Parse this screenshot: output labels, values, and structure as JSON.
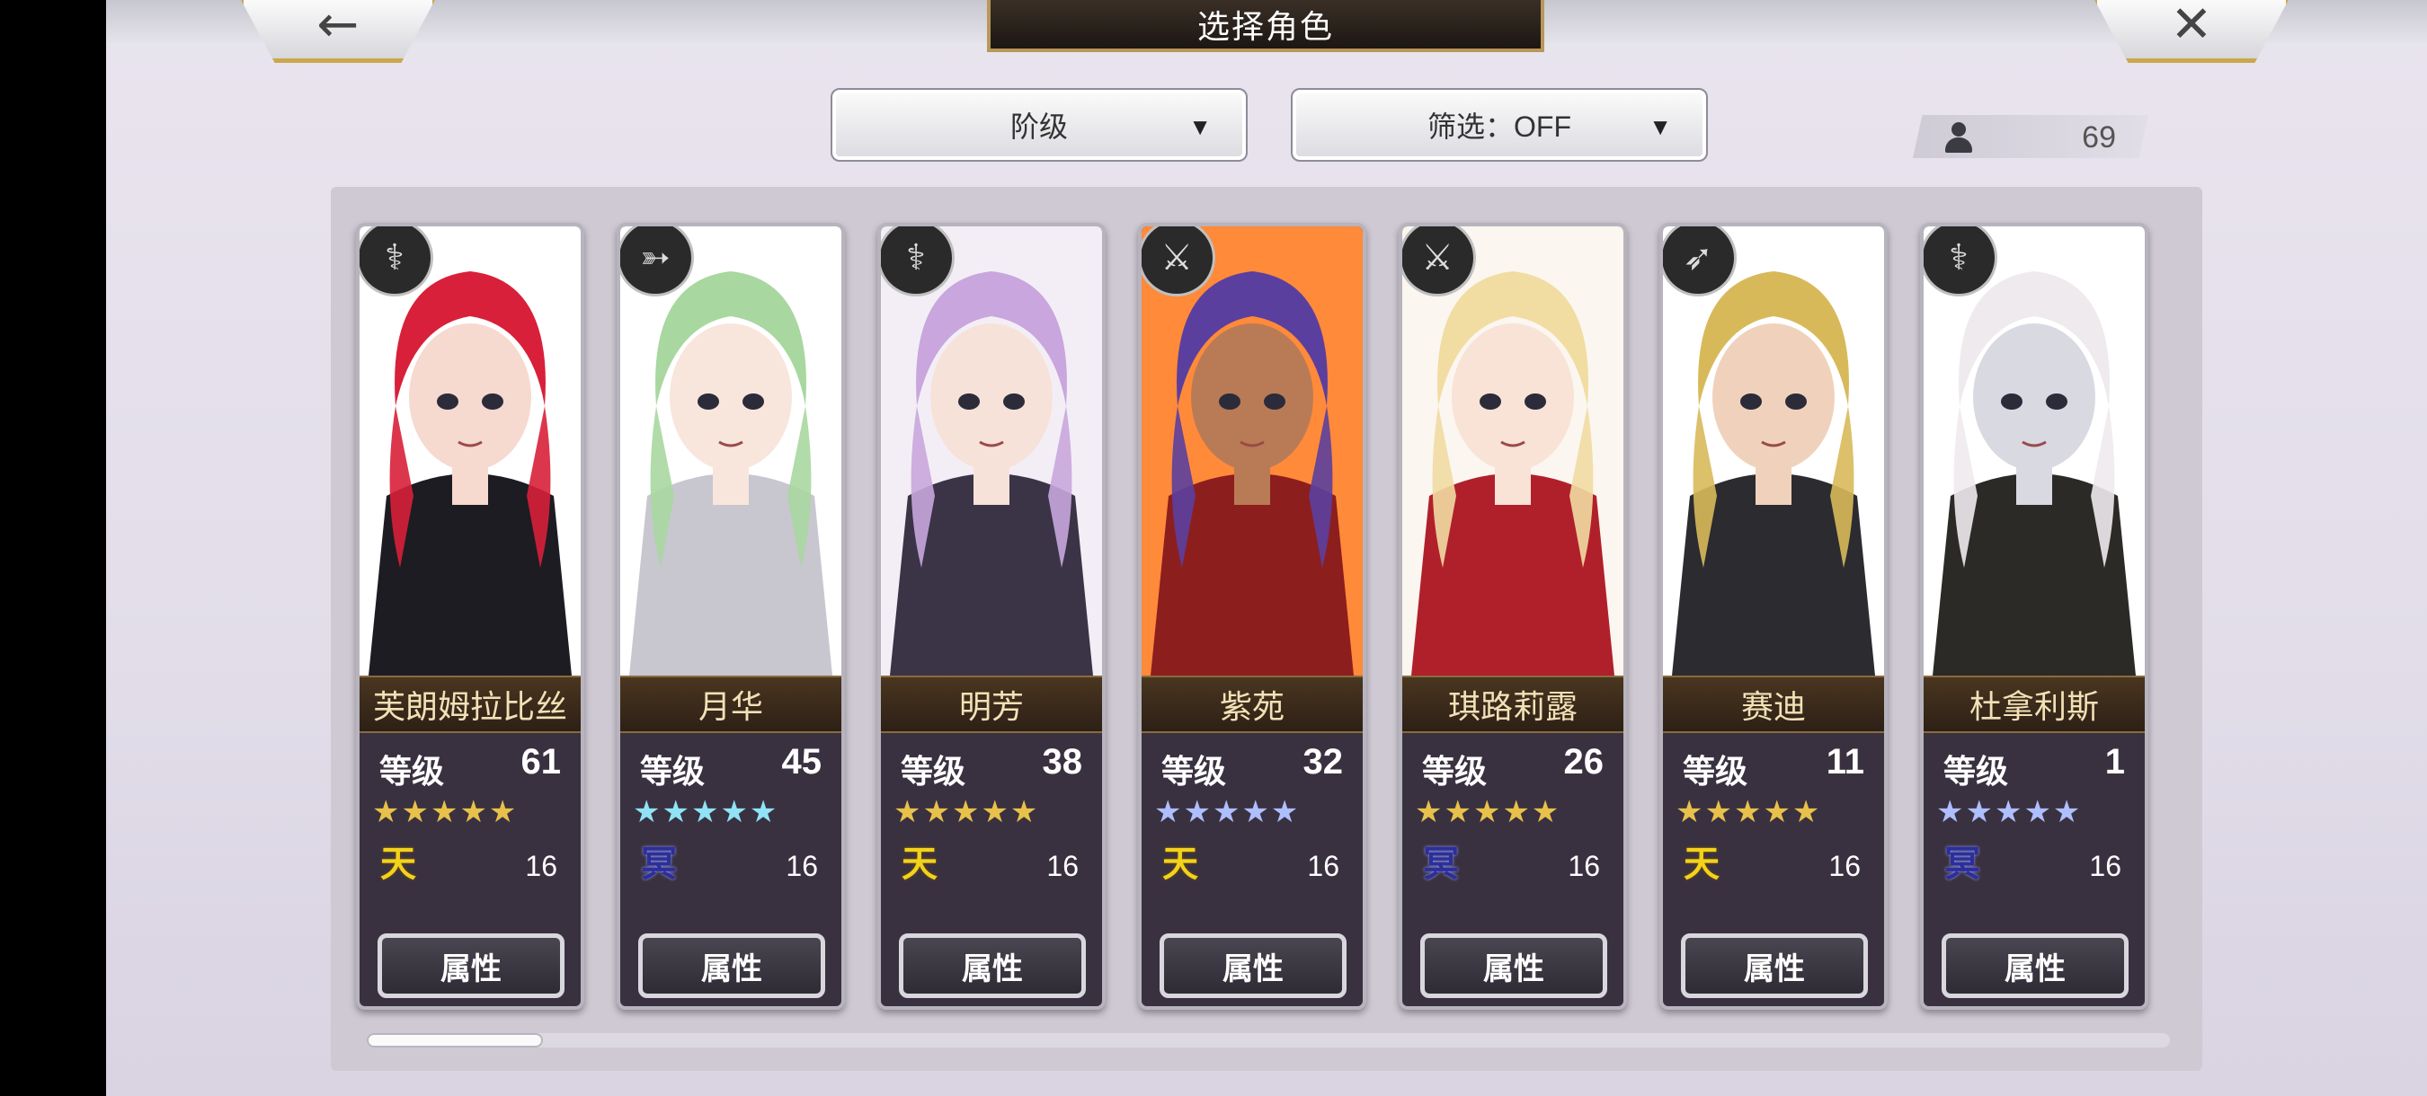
{
  "header": {
    "title": "选择角色",
    "back_icon": "back-arrow-icon",
    "close_icon": "close-icon"
  },
  "filters": {
    "sort_label": "阶级",
    "filter_label": "筛选：OFF"
  },
  "roster_count": "69",
  "level_label": "等级",
  "attribute_button": "属性",
  "colors": {
    "gold_star": "#e8c14a",
    "blue_star": "#9fb7ff",
    "heaven_element": "#f3d21c",
    "underworld_element": "#2c2f9a"
  },
  "characters": [
    {
      "name": "芙朗姆拉比丝",
      "level": "61",
      "stars": "★★★★★",
      "star_color": "gold",
      "element": "天",
      "element_type": "heaven",
      "cost": "16",
      "weapon_icon": "staff-icon"
    },
    {
      "name": "月华",
      "level": "45",
      "stars": "★★★★★",
      "star_color": "cyan",
      "element": "冥",
      "element_type": "underworld",
      "cost": "16",
      "weapon_icon": "bow-icon"
    },
    {
      "name": "明芳",
      "level": "38",
      "stars": "★★★★★",
      "star_color": "gold",
      "element": "天",
      "element_type": "heaven",
      "cost": "16",
      "weapon_icon": "staff-icon"
    },
    {
      "name": "紫苑",
      "level": "32",
      "stars": "★★★★★",
      "star_color": "blue",
      "element": "天",
      "element_type": "heaven",
      "cost": "16",
      "weapon_icon": "sword-icon"
    },
    {
      "name": "琪路莉露",
      "level": "26",
      "stars": "★★★★★",
      "star_color": "gold",
      "element": "冥",
      "element_type": "underworld",
      "cost": "16",
      "weapon_icon": "sword-icon"
    },
    {
      "name": "赛迪",
      "level": "11",
      "stars": "★★★★★",
      "star_color": "gold",
      "element": "天",
      "element_type": "heaven",
      "cost": "16",
      "weapon_icon": "spear-icon"
    },
    {
      "name": "杜拿利斯",
      "level": "1",
      "stars": "★★★★★",
      "star_color": "blue",
      "element": "冥",
      "element_type": "underworld",
      "cost": "16",
      "weapon_icon": "staff-icon"
    }
  ]
}
